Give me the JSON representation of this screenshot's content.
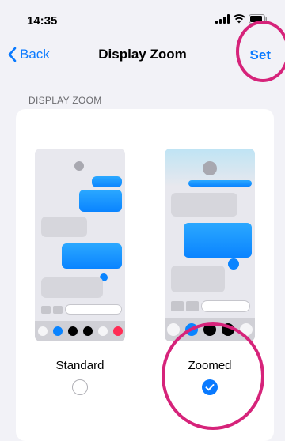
{
  "status": {
    "time": "14:35"
  },
  "nav": {
    "back_label": "Back",
    "title": "Display Zoom",
    "set_label": "Set"
  },
  "section": {
    "label": "DISPLAY ZOOM"
  },
  "options": [
    {
      "label": "Standard",
      "selected": false
    },
    {
      "label": "Zoomed",
      "selected": true
    }
  ],
  "colors": {
    "accent": "#0a7aff",
    "annotation": "#d6237a",
    "bubble_blue": "#0a84ff"
  }
}
